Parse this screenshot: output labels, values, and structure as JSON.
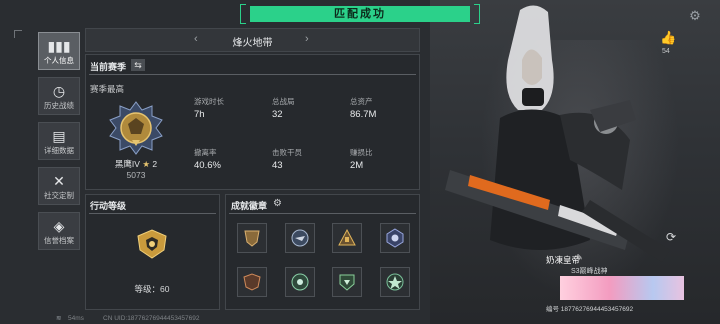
{
  "top": {
    "banner": "匹配成功"
  },
  "sidebar": {
    "items": [
      {
        "label": "个人信息",
        "icon": "bar-chart-icon",
        "active": true
      },
      {
        "label": "历史战绩",
        "icon": "clock-icon"
      },
      {
        "label": "详细数据",
        "icon": "document-icon"
      },
      {
        "label": "社交定制",
        "icon": "tools-icon"
      },
      {
        "label": "信誉档案",
        "icon": "shield-icon"
      }
    ]
  },
  "map": {
    "title": "烽火地带"
  },
  "season": {
    "title": "当前赛季",
    "subtitle": "赛季最高",
    "rank_name": "黑鹰IV",
    "rank_stars": "2",
    "score": "5073",
    "stats": [
      {
        "label": "游戏时长",
        "value": "7h"
      },
      {
        "label": "总战局",
        "value": "32"
      },
      {
        "label": "总资产",
        "value": "86.7M"
      },
      {
        "label": "撤离率",
        "value": "40.6%"
      },
      {
        "label": "击败干员",
        "value": "43"
      },
      {
        "label": "赚损比",
        "value": "2M"
      }
    ]
  },
  "level": {
    "title": "行动等级",
    "text": "等级：60"
  },
  "achievements": {
    "title": "成就徽章"
  },
  "profile": {
    "likes": "54",
    "name": "奶凍皇帝",
    "subtitle": "S3巅峰战神",
    "id_text": "编号 18776276944453457692"
  },
  "bottom": {
    "ping": "54ms",
    "uid": "CN UID:18776276944453457692"
  },
  "colors": {
    "accent_green": "#2bd18a",
    "panel_bg": "#26292d"
  }
}
